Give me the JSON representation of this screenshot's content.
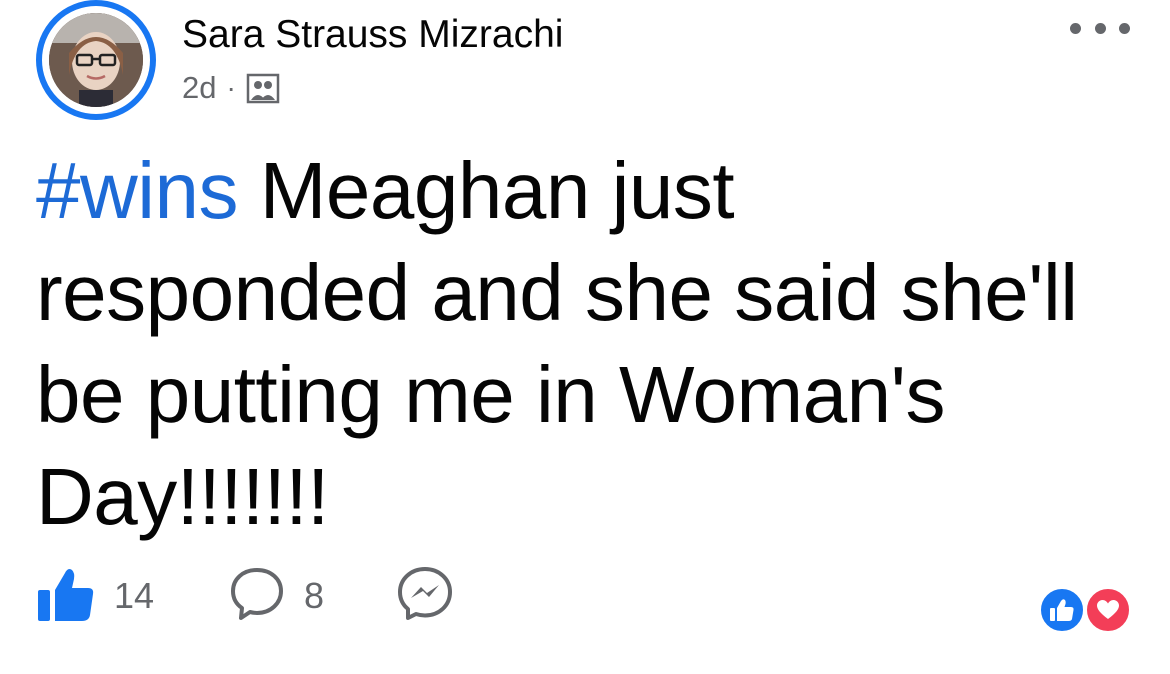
{
  "author": {
    "name": "Sara Strauss Mizrachi",
    "timestamp": "2d",
    "separator": "·",
    "audience_icon": "group-audience-icon"
  },
  "header": {
    "more_icon": "more-options-icon"
  },
  "post": {
    "hashtag": "#wins",
    "text": " Meaghan just responded and she said she'll be putting me in Woman's Day!!!!!!!"
  },
  "actions": {
    "like_count": "14",
    "comment_count": "8",
    "like_icon": "thumbs-up-icon",
    "comment_icon": "comment-bubble-icon",
    "share_icon": "messenger-icon"
  },
  "reactions": [
    "like",
    "love"
  ],
  "colors": {
    "accent_blue": "#1877f2",
    "hashtag_blue": "#1d6ad6",
    "love_red": "#f33e58",
    "muted_text": "#65676b"
  }
}
